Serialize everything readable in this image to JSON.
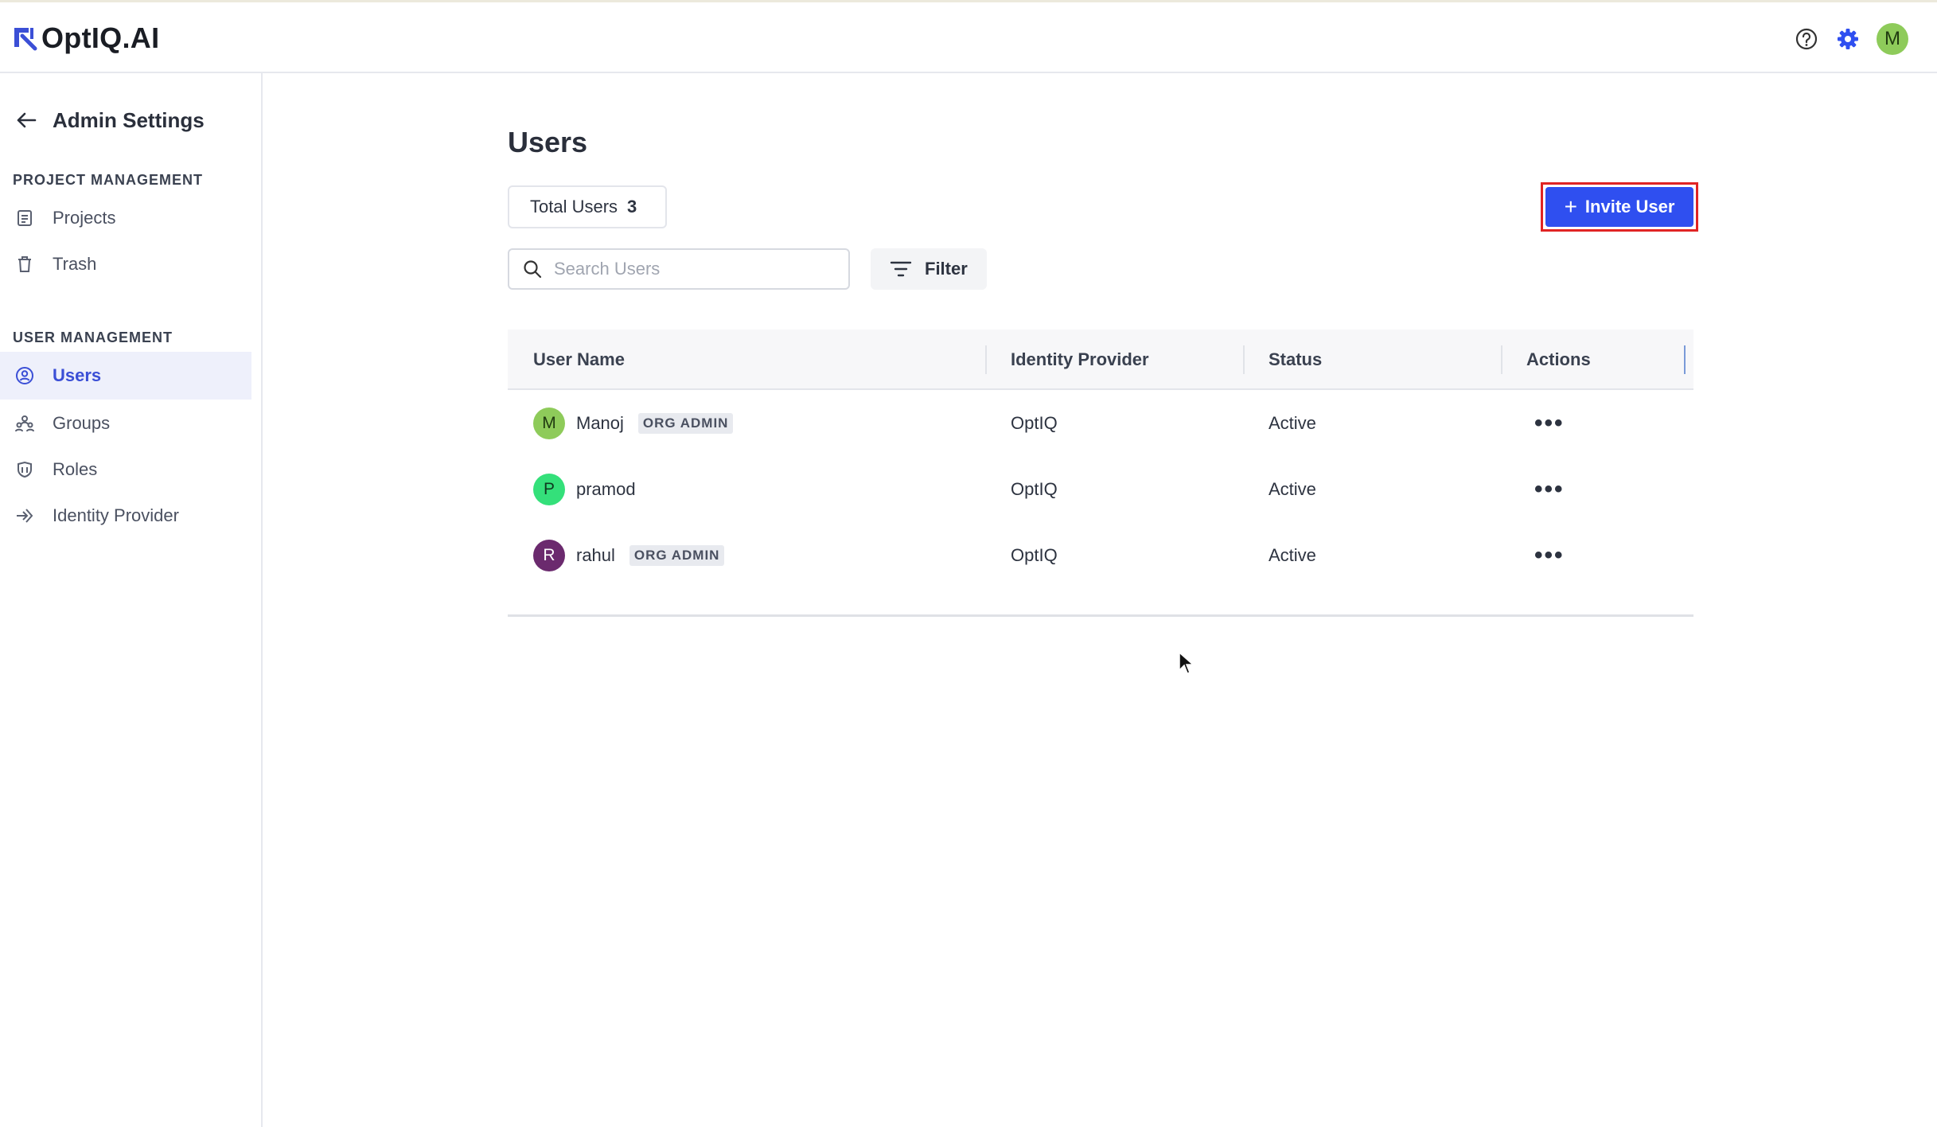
{
  "app": {
    "logo_text": "OptIQ.AI",
    "user_initial": "M"
  },
  "sidebar": {
    "back_title": "Admin Settings",
    "sections": [
      {
        "label": "PROJECT MANAGEMENT"
      },
      {
        "label": "USER MANAGEMENT"
      }
    ],
    "items": [
      {
        "label": "Projects",
        "icon": "projects-icon"
      },
      {
        "label": "Trash",
        "icon": "trash-icon"
      },
      {
        "label": "Users",
        "icon": "users-icon",
        "active": true
      },
      {
        "label": "Groups",
        "icon": "groups-icon"
      },
      {
        "label": "Roles",
        "icon": "roles-icon"
      },
      {
        "label": "Identity Provider",
        "icon": "identity-provider-icon"
      }
    ]
  },
  "main": {
    "title": "Users",
    "total_label": "Total Users",
    "total_count": "3",
    "invite_label": "Invite User",
    "search_placeholder": "Search Users",
    "search_value": "",
    "filter_label": "Filter"
  },
  "table": {
    "columns": [
      "User Name",
      "Identity Provider",
      "Status",
      "Actions"
    ],
    "rows": [
      {
        "initial": "M",
        "name": "Manoj",
        "badge": "ORG ADMIN",
        "provider": "OptIQ",
        "status": "Active",
        "avatar_color": "#8ecb5a",
        "avatar_text_color": "#1f3a10"
      },
      {
        "initial": "P",
        "name": "pramod",
        "badge": "",
        "provider": "OptIQ",
        "status": "Active",
        "avatar_color": "#34e07a",
        "avatar_text_color": "#0f3a20"
      },
      {
        "initial": "R",
        "name": "rahul",
        "badge": "ORG ADMIN",
        "provider": "OptIQ",
        "status": "Active",
        "avatar_color": "#6b2a6e",
        "avatar_text_color": "#ffffff"
      }
    ]
  },
  "colors": {
    "accent": "#2f4ff0",
    "highlight_border": "#e02424",
    "active_nav_bg": "#eef0fb",
    "active_nav_text": "#3b4fd6"
  }
}
